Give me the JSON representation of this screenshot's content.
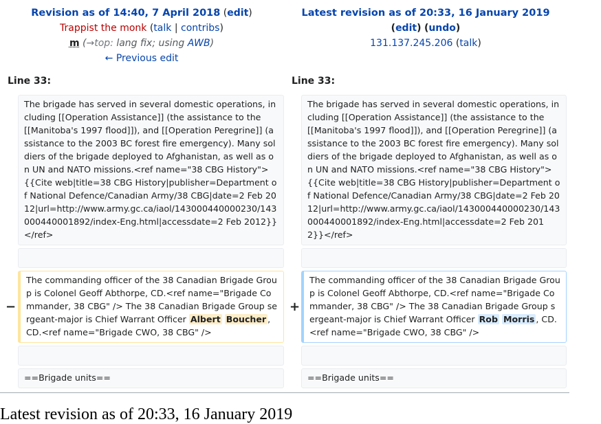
{
  "left_header": {
    "title": "Revision as of 14:40, 7 April 2018",
    "edit_label": "edit",
    "user": "Trappist the monk",
    "talk_label": "talk",
    "contribs_label": "contribs",
    "minor_flag": "m",
    "comment_arrow": "→top:",
    "comment_text": " lang fix; using ",
    "comment_link": "AWB",
    "prev_edit": "← Previous edit"
  },
  "right_header": {
    "title": "Latest revision as of 20:33, 16 January 2019",
    "edit_label": "edit",
    "undo_label": "undo",
    "ip": "131.137.245.206",
    "talk_label": "talk"
  },
  "line_label": "Line 33:",
  "blocks": {
    "context1": "The brigade has served in several domestic operations, including [[Operation Assistance]] (the assistance to the [[Manitoba's 1997 flood]]), and [[Operation Peregrine]] (assistance to the 2003 BC forest fire emergency). Many soldiers of the brigade deployed to Afghanistan, as well as on UN and NATO missions.<ref name=\"38 CBG History\">{{Cite web|title=38 CBG History|publisher=Department of National Defence/Canadian Army/38 CBG|date=2 Feb 2012|url=http://www.army.gc.ca/iaol/143000440000230/143000440001892/index-Eng.html|accessdate=2 Feb 2012}}</ref>",
    "changed_prefix": "The commanding officer of the 38 Canadian Brigade Group is Colonel Geoff Abthorpe, CD.<ref name=\"Brigade Commander, 38 CBG\" /> The 38 Canadian Brigade Group sergeant-major is Chief Warrant Officer ",
    "del_word1": "Albert",
    "del_word2": "Boucher",
    "add_word1": "Rob",
    "add_word2": "Morris",
    "changed_suffix": ", CD.<ref name=\"Brigade CWO, 38 CBG\" />",
    "context2": "==Brigade units=="
  },
  "markers": {
    "minus": "−",
    "plus": "+"
  },
  "bottom_title": "Latest revision as of 20:33, 16 January 2019",
  "colors": {
    "link": "#0645ad",
    "user_red": "#ba0000",
    "del_border": "#ffe49c",
    "add_border": "#a3d3ff"
  }
}
